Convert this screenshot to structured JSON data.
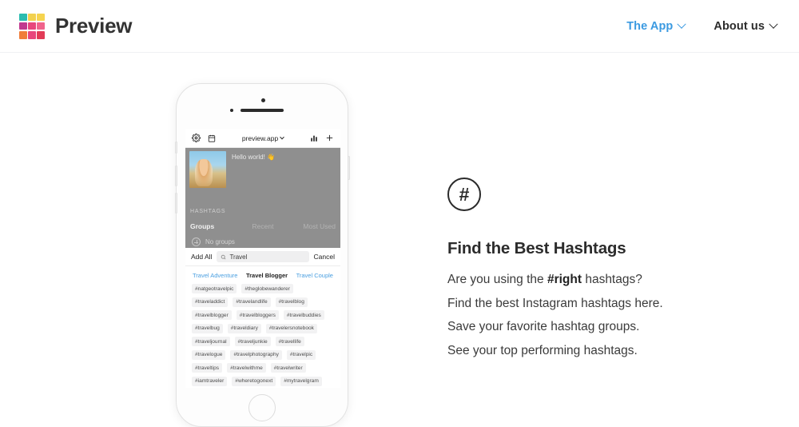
{
  "header": {
    "brand_name": "Preview",
    "logo_colors": [
      "#2bbcb0",
      "#f2d14e",
      "#f6d44f",
      "#c0398f",
      "#e8467c",
      "#f0648c",
      "#f07d3a",
      "#e8467c",
      "#e23b57"
    ],
    "nav": [
      {
        "label": "The App",
        "icon": "chevron-down-icon",
        "accent": "#3b9ae1"
      },
      {
        "label": "About us",
        "icon": "chevron-down-icon",
        "accent": "#2c2c2c"
      }
    ]
  },
  "phone": {
    "app_bar": {
      "gear_icon": "gear-icon",
      "calendar_icon": "calendar-icon",
      "title": "preview.app",
      "dropdown_icon": "chevron-down-icon",
      "analytics_icon": "bar-chart-icon",
      "add_icon": "plus-icon"
    },
    "post": {
      "caption": "Hello world! 👋"
    },
    "hashtags_section_label": "HASHTAGS",
    "group_tabs": [
      {
        "label": "Groups",
        "active": true
      },
      {
        "label": "Recent",
        "active": false
      },
      {
        "label": "Most Used",
        "active": false
      }
    ],
    "no_groups_label": "No groups",
    "search": {
      "add_all_label": "Add All",
      "search_icon": "search-icon",
      "value": "Travel",
      "cancel_label": "Cancel"
    },
    "category_tabs": [
      {
        "label": "Travel Adventure",
        "active": false
      },
      {
        "label": "Travel Blogger",
        "active": true
      },
      {
        "label": "Travel Couple",
        "active": false
      }
    ],
    "hashtag_rows": [
      [
        "#natgeotravelpic",
        "#theglobewanderer"
      ],
      [
        "#traveladdict",
        "#travelandlife",
        "#travelblog"
      ],
      [
        "#travelblogger",
        "#travelbloggers",
        "#travelbuddies"
      ],
      [
        "#travelbug",
        "#traveldiary",
        "#travelersnotebook"
      ],
      [
        "#traveljournal",
        "#traveljunkie",
        "#travellife"
      ],
      [
        "#travelogue",
        "#travelphotography",
        "#travelpic"
      ],
      [
        "#traveltips",
        "#travelwithme",
        "#travelwriter"
      ],
      [
        "#iamtraveler",
        "#wheretogonext",
        "#mytravelgram"
      ]
    ]
  },
  "feature": {
    "icon": "hashtag-circle-icon",
    "icon_glyph": "#",
    "title": "Find the Best Hashtags",
    "lines": [
      {
        "pre": "Are you using the ",
        "bold": "#right",
        "post": " hashtags?"
      },
      {
        "pre": "Find the best Instagram hashtags here.",
        "bold": "",
        "post": ""
      },
      {
        "pre": "Save your favorite hashtag groups.",
        "bold": "",
        "post": ""
      },
      {
        "pre": "See your top performing hashtags.",
        "bold": "",
        "post": ""
      }
    ]
  }
}
